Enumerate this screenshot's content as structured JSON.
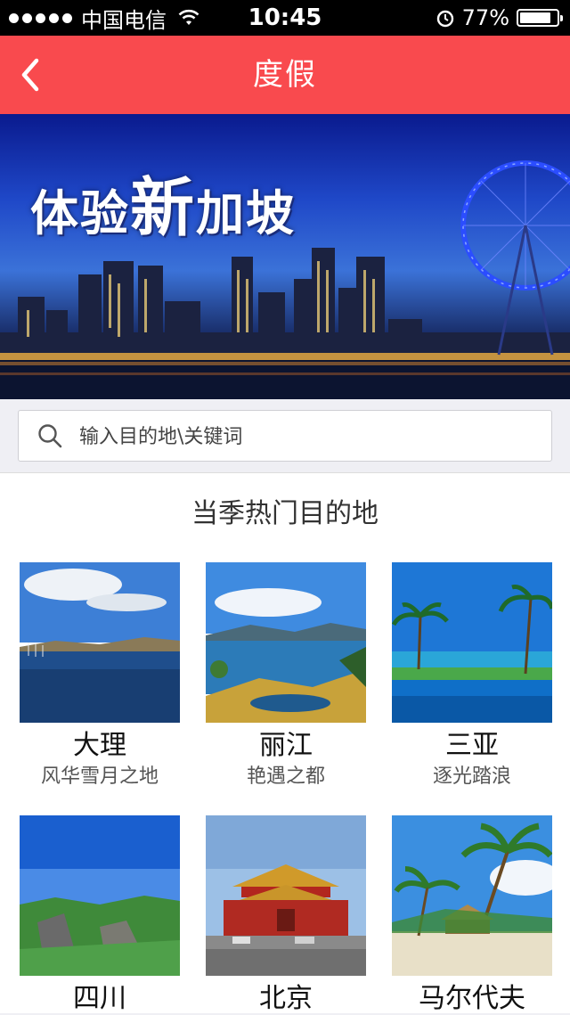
{
  "status_bar": {
    "carrier": "中国电信",
    "time": "10:45",
    "battery": "77%",
    "battery_level": 0.77
  },
  "navbar": {
    "title": "度假",
    "back_icon": "chevron-left-icon"
  },
  "banner": {
    "text_left": "体验",
    "text_big": "新",
    "text_right": "加坡"
  },
  "search": {
    "placeholder": "输入目的地\\关键词",
    "icon": "search-icon"
  },
  "section": {
    "title": "当季热门目的地"
  },
  "destinations": [
    {
      "name": "大理",
      "desc": "风华雪月之地"
    },
    {
      "name": "丽江",
      "desc": "艳遇之都"
    },
    {
      "name": "三亚",
      "desc": "逐光踏浪"
    },
    {
      "name": "四川",
      "desc": ""
    },
    {
      "name": "北京",
      "desc": ""
    },
    {
      "name": "马尔代夫",
      "desc": ""
    }
  ],
  "colors": {
    "nav_red": "#f94a4e",
    "status_bg": "#000000",
    "page_bg": "#efeff4"
  }
}
